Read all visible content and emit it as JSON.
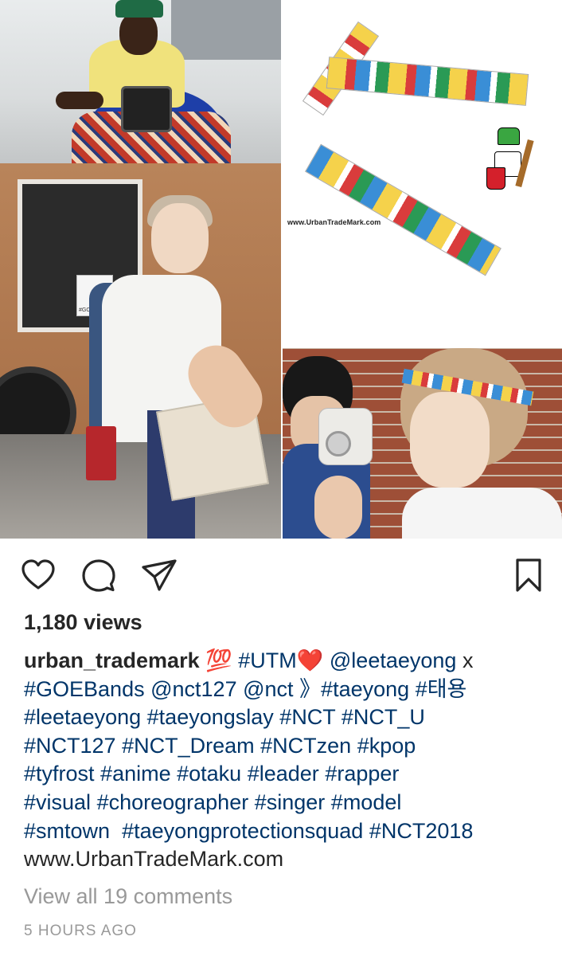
{
  "collage": {
    "product_url": "www.UrbanTradeMark.com",
    "sticker_text": "#GOEvibes"
  },
  "actions": {
    "like_icon": "heart-outline-icon",
    "comment_icon": "speech-bubble-icon",
    "share_icon": "paper-plane-icon",
    "save_icon": "bookmark-icon"
  },
  "views": "1,180 views",
  "caption": {
    "username": "urban_trademark",
    "emoji_hundred": "💯",
    "tag_utm": "#UTM",
    "emoji_heart": "❤️",
    "mention_leetaeyong": "@leetaeyong",
    "x": "x",
    "line2": [
      "#GOEBands",
      "@nct127",
      "@nct",
      "》#taeyong",
      "#태용"
    ],
    "line3": [
      "#leetaeyong",
      "#taeyongslay",
      "#NCT",
      "#NCT_U"
    ],
    "line4": [
      "#NCT127",
      "#NCT_Dream",
      "#NCTzen",
      "#kpop"
    ],
    "line5": [
      "#tyfrost",
      "#anime",
      "#otaku",
      "#leader",
      "#rapper"
    ],
    "line6": [
      "#visual",
      "#choreographer",
      "#singer",
      "#model"
    ],
    "line7": [
      "#smtown",
      "#taeyongprotectionsquad",
      "#NCT2018"
    ],
    "website": "www.UrbanTradeMark.com"
  },
  "view_all_comments": "View all 19 comments",
  "time_ago": "5 HOURS AGO",
  "colors": {
    "text": "#262626",
    "hashtag": "#003569",
    "muted": "#999999",
    "background": "#ffffff"
  }
}
